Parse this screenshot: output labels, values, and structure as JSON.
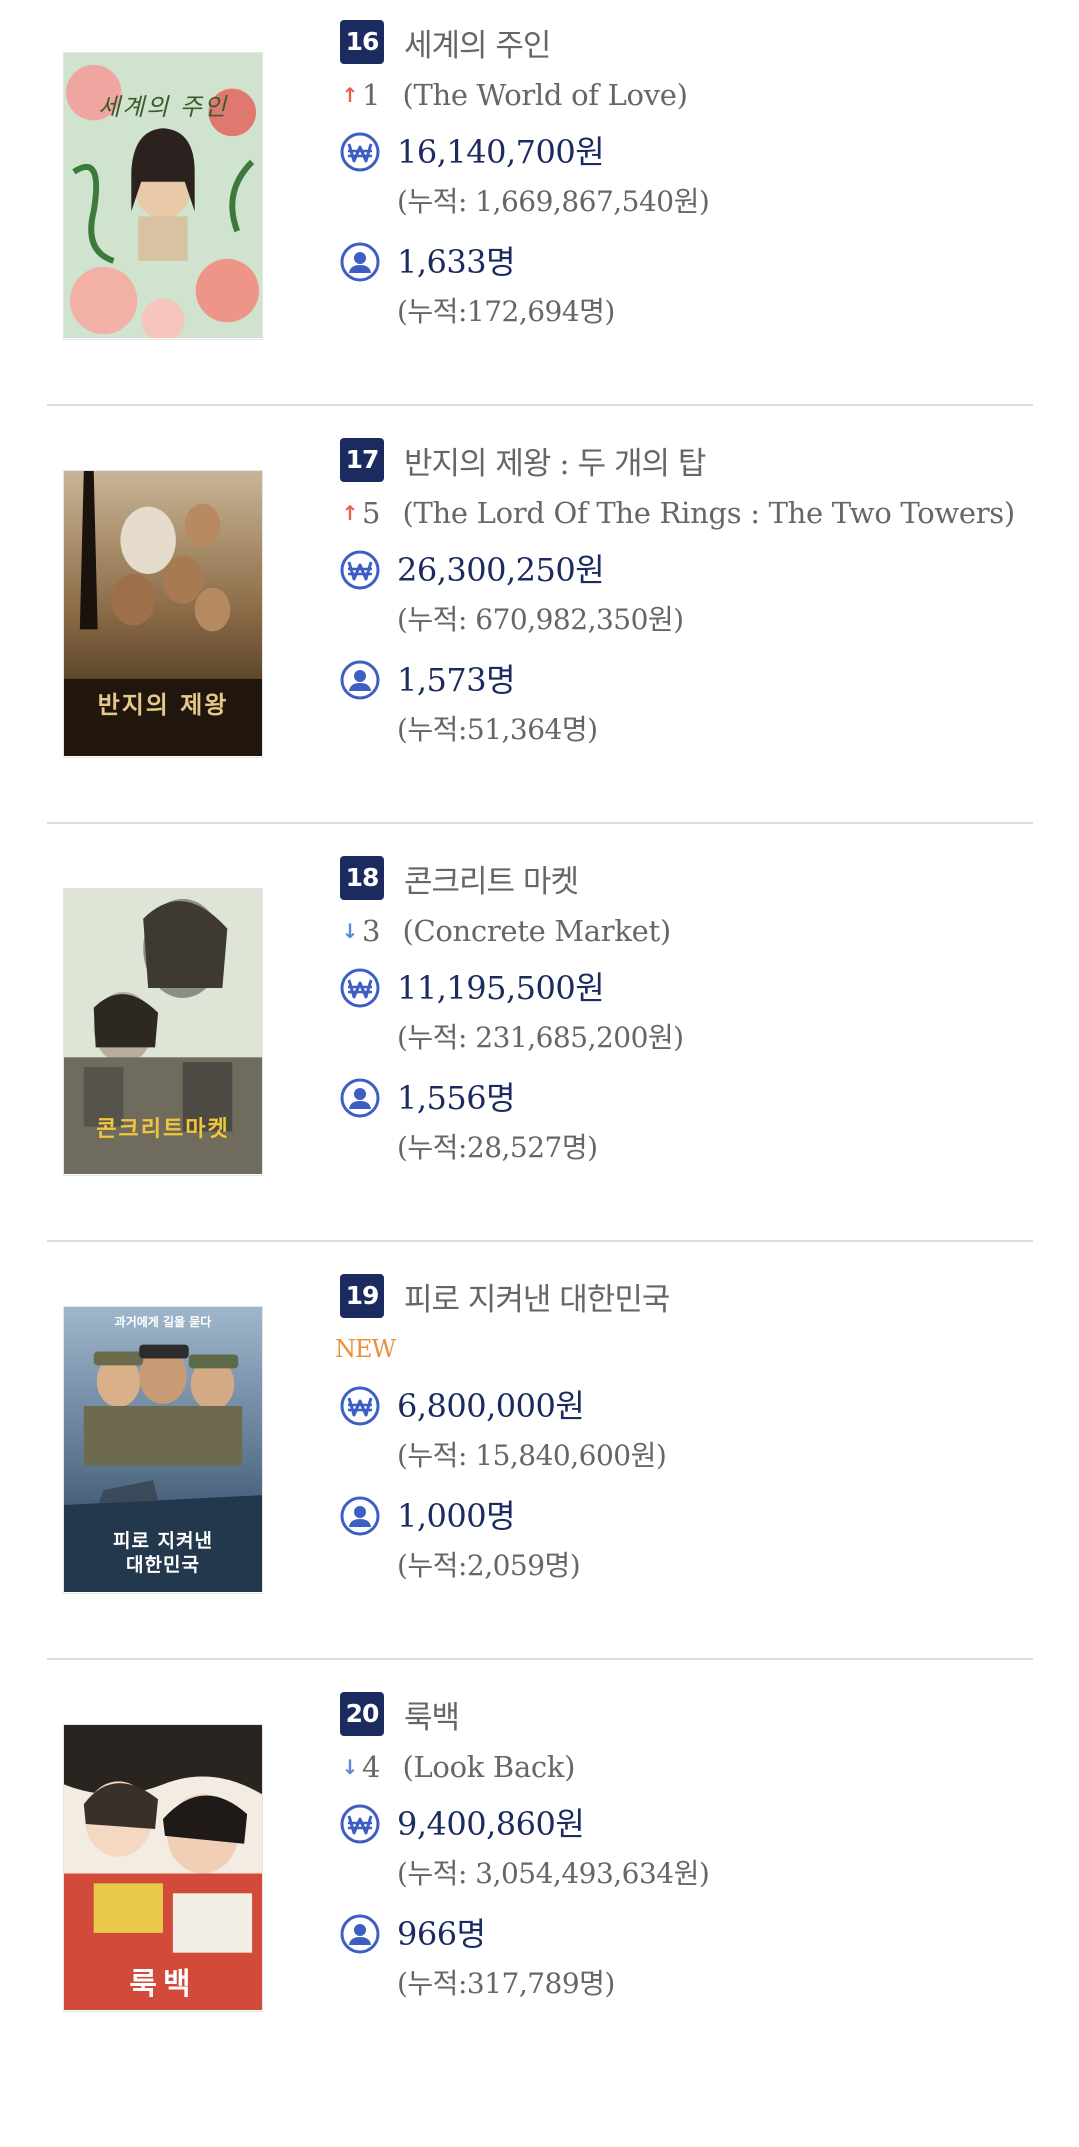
{
  "movies": [
    {
      "rank": "16",
      "title_ko": "세계의 주인",
      "change_dir": "up",
      "change_arrow": "↑",
      "change": "1",
      "title_en": "(The World of Love)",
      "is_new": false,
      "revenue": "16,140,700원",
      "revenue_cum": "(누적: 1,669,867,540원)",
      "audience": "1,633명",
      "audience_cum": "(누적:172,694명)",
      "poster_text": "세계의 주인"
    },
    {
      "rank": "17",
      "title_ko": "반지의 제왕 : 두 개의 탑",
      "change_dir": "up",
      "change_arrow": "↑",
      "change": "5",
      "title_en": "(The Lord Of The Rings : The Two Towers)",
      "is_new": false,
      "revenue": "26,300,250원",
      "revenue_cum": "(누적: 670,982,350원)",
      "audience": "1,573명",
      "audience_cum": "(누적:51,364명)",
      "poster_text": "반지의 제왕"
    },
    {
      "rank": "18",
      "title_ko": "콘크리트 마켓",
      "change_dir": "down",
      "change_arrow": "↓",
      "change": "3",
      "title_en": "(Concrete Market)",
      "is_new": false,
      "revenue": "11,195,500원",
      "revenue_cum": "(누적: 231,685,200원)",
      "audience": "1,556명",
      "audience_cum": "(누적:28,527명)",
      "poster_text": "콘크리트마켓"
    },
    {
      "rank": "19",
      "title_ko": "피로 지켜낸 대한민국",
      "change_dir": "new",
      "new_label": "NEW",
      "is_new": true,
      "revenue": "6,800,000원",
      "revenue_cum": "(누적: 15,840,600원)",
      "audience": "1,000명",
      "audience_cum": "(누적:2,059명)",
      "poster_text": "피로 지켜낸 대한민국",
      "poster_tagline": "과거에게 길을 묻다"
    },
    {
      "rank": "20",
      "title_ko": "룩백",
      "change_dir": "down",
      "change_arrow": "↓",
      "change": "4",
      "title_en": "(Look Back)",
      "is_new": false,
      "revenue": "9,400,860원",
      "revenue_cum": "(누적: 3,054,493,634원)",
      "audience": "966명",
      "audience_cum": "(누적:317,789명)",
      "poster_text": "룩백"
    }
  ],
  "icons": {
    "revenue": "won-icon",
    "audience": "person-icon"
  },
  "colors": {
    "navy": "#1b2b5f",
    "icon_blue": "#3d5fc4",
    "up": "#e8604c",
    "down": "#5b8bd8",
    "new": "#e8923a"
  }
}
